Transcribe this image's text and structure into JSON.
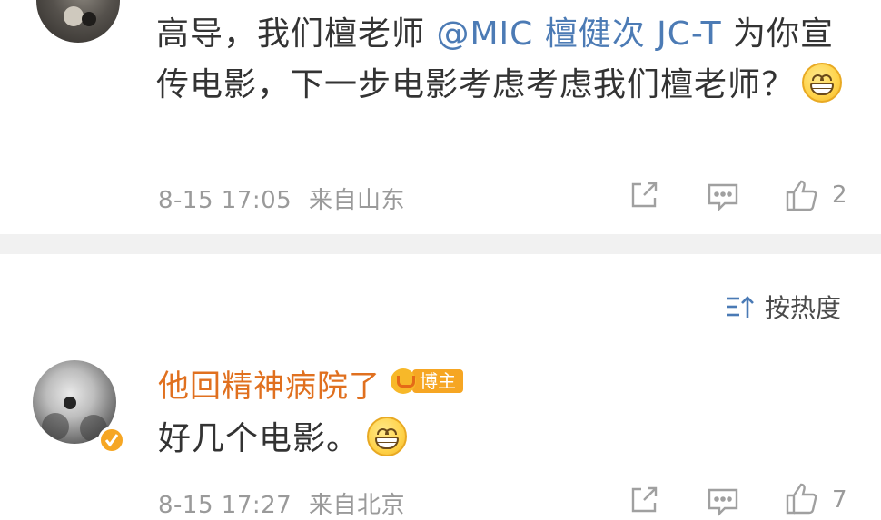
{
  "post": {
    "text_part1": "高导，我们檀老师 ",
    "mention": "@MIC 檀健次 JC-T",
    "text_part2": " 为你宣传电影，下一步电影考虑考虑我们檀老师？",
    "emoji": "grin-emoji",
    "date": "8-15 17:05",
    "location": "来自山东",
    "like_count": "2"
  },
  "sort": {
    "label": "按热度"
  },
  "reply": {
    "username": "他回精神病院了",
    "badge_label": "博主",
    "text": "好几个电影。",
    "emoji": "grin-emoji",
    "date": "8-15 17:27",
    "location": "来自北京",
    "like_count": "7"
  },
  "icons": {
    "share": "share-icon",
    "comment": "comment-icon",
    "like": "thumbs-up-icon",
    "sort": "sort-icon",
    "verified": "verified-badge-icon"
  },
  "colors": {
    "mention": "#4c7bb5",
    "username": "#e0701f",
    "badge": "#f6a623",
    "meta": "#9a9a9a",
    "divider": "#f1f1f1"
  }
}
